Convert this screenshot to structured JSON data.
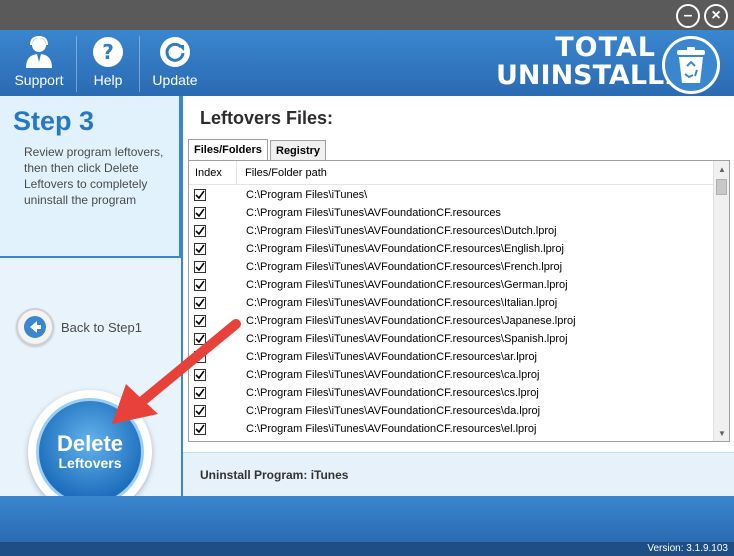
{
  "window": {
    "minimize_icon": "minimize-icon",
    "close_icon": "close-icon"
  },
  "toolbar": {
    "support_label": "Support",
    "help_label": "Help",
    "update_label": "Update"
  },
  "brand": {
    "line1": "TOTAL",
    "line2": "UNINSTALLER"
  },
  "left": {
    "step_title": "Step 3",
    "step_desc": "Review program leftovers, then then click Delete Leftovers to completely uninstall the program",
    "back_label": "Back to Step1",
    "delete_line1": "Delete",
    "delete_line2": "Leftovers"
  },
  "main": {
    "title": "Leftovers Files:",
    "tabs": [
      {
        "label": "Files/Folders"
      },
      {
        "label": "Registry"
      }
    ],
    "columns": {
      "index": "Index",
      "path": "Files/Folder path"
    },
    "rows": [
      {
        "checked": true,
        "path": "C:\\Program Files\\iTunes\\"
      },
      {
        "checked": true,
        "path": "C:\\Program Files\\iTunes\\AVFoundationCF.resources"
      },
      {
        "checked": true,
        "path": "C:\\Program Files\\iTunes\\AVFoundationCF.resources\\Dutch.lproj"
      },
      {
        "checked": true,
        "path": "C:\\Program Files\\iTunes\\AVFoundationCF.resources\\English.lproj"
      },
      {
        "checked": true,
        "path": "C:\\Program Files\\iTunes\\AVFoundationCF.resources\\French.lproj"
      },
      {
        "checked": true,
        "path": "C:\\Program Files\\iTunes\\AVFoundationCF.resources\\German.lproj"
      },
      {
        "checked": true,
        "path": "C:\\Program Files\\iTunes\\AVFoundationCF.resources\\Italian.lproj"
      },
      {
        "checked": true,
        "path": "C:\\Program Files\\iTunes\\AVFoundationCF.resources\\Japanese.lproj"
      },
      {
        "checked": true,
        "path": "C:\\Program Files\\iTunes\\AVFoundationCF.resources\\Spanish.lproj"
      },
      {
        "checked": true,
        "path": "C:\\Program Files\\iTunes\\AVFoundationCF.resources\\ar.lproj"
      },
      {
        "checked": true,
        "path": "C:\\Program Files\\iTunes\\AVFoundationCF.resources\\ca.lproj"
      },
      {
        "checked": true,
        "path": "C:\\Program Files\\iTunes\\AVFoundationCF.resources\\cs.lproj"
      },
      {
        "checked": true,
        "path": "C:\\Program Files\\iTunes\\AVFoundationCF.resources\\da.lproj"
      },
      {
        "checked": true,
        "path": "C:\\Program Files\\iTunes\\AVFoundationCF.resources\\el.lproj"
      }
    ],
    "uninstall_label": "Uninstall Program:",
    "uninstall_program": "iTunes"
  },
  "footer": {
    "version": "Version:  3.1.9.103"
  },
  "colors": {
    "header_blue": "#2f7bc4",
    "accent_blue": "#2878c8",
    "annotation_red": "#e8413a"
  }
}
